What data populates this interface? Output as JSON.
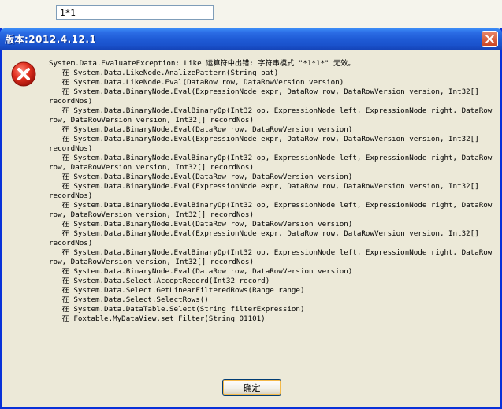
{
  "background_app": {
    "input_value": "1*1"
  },
  "dialog": {
    "title": "版本:2012.4.12.1",
    "close_icon": "close-icon",
    "error_icon": "error-icon",
    "message_lines": [
      "System.Data.EvaluateException: Like 运算符中出错: 字符串模式 \"*1*1*\" 无效。",
      "   在 System.Data.LikeNode.AnalizePattern(String pat)",
      "   在 System.Data.LikeNode.Eval(DataRow row, DataRowVersion version)",
      "   在 System.Data.BinaryNode.Eval(ExpressionNode expr, DataRow row, DataRowVersion version, Int32[] recordNos)",
      "   在 System.Data.BinaryNode.EvalBinaryOp(Int32 op, ExpressionNode left, ExpressionNode right, DataRow row, DataRowVersion version, Int32[] recordNos)",
      "   在 System.Data.BinaryNode.Eval(DataRow row, DataRowVersion version)",
      "   在 System.Data.BinaryNode.Eval(ExpressionNode expr, DataRow row, DataRowVersion version, Int32[] recordNos)",
      "   在 System.Data.BinaryNode.EvalBinaryOp(Int32 op, ExpressionNode left, ExpressionNode right, DataRow row, DataRowVersion version, Int32[] recordNos)",
      "   在 System.Data.BinaryNode.Eval(DataRow row, DataRowVersion version)",
      "   在 System.Data.BinaryNode.Eval(ExpressionNode expr, DataRow row, DataRowVersion version, Int32[] recordNos)",
      "   在 System.Data.BinaryNode.EvalBinaryOp(Int32 op, ExpressionNode left, ExpressionNode right, DataRow row, DataRowVersion version, Int32[] recordNos)",
      "   在 System.Data.BinaryNode.Eval(DataRow row, DataRowVersion version)",
      "   在 System.Data.BinaryNode.Eval(ExpressionNode expr, DataRow row, DataRowVersion version, Int32[] recordNos)",
      "   在 System.Data.BinaryNode.EvalBinaryOp(Int32 op, ExpressionNode left, ExpressionNode right, DataRow row, DataRowVersion version, Int32[] recordNos)",
      "   在 System.Data.BinaryNode.Eval(DataRow row, DataRowVersion version)",
      "   在 System.Data.Select.AcceptRecord(Int32 record)",
      "   在 System.Data.Select.GetLinearFilteredRows(Range range)",
      "   在 System.Data.Select.SelectRows()",
      "   在 System.Data.DataTable.Select(String filterExpression)",
      "   在 Foxtable.MyDataView.set_Filter(String 01101)"
    ],
    "ok_label": "确定"
  },
  "colors": {
    "titlebar": "#1f5bd6",
    "dialog_bg": "#ece9d8",
    "error_red": "#d8261a",
    "close_red": "#c9421f"
  }
}
